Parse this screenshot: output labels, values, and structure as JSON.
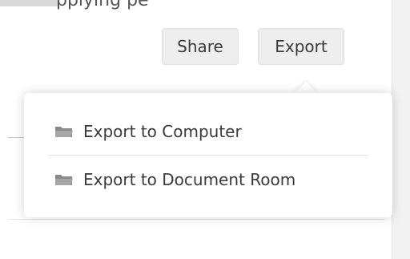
{
  "top": {
    "fragment": "pplying pe"
  },
  "toolbar": {
    "share_label": "Share",
    "export_label": "Export"
  },
  "export_menu": {
    "items": [
      {
        "label": "Export to Computer",
        "icon": "folder-icon"
      },
      {
        "label": "Export to Document Room",
        "icon": "folder-icon"
      }
    ]
  },
  "colors": {
    "icon": "#8a8a8a",
    "button_bg": "#eeeeee",
    "panel_bg": "#f2f2f2"
  }
}
